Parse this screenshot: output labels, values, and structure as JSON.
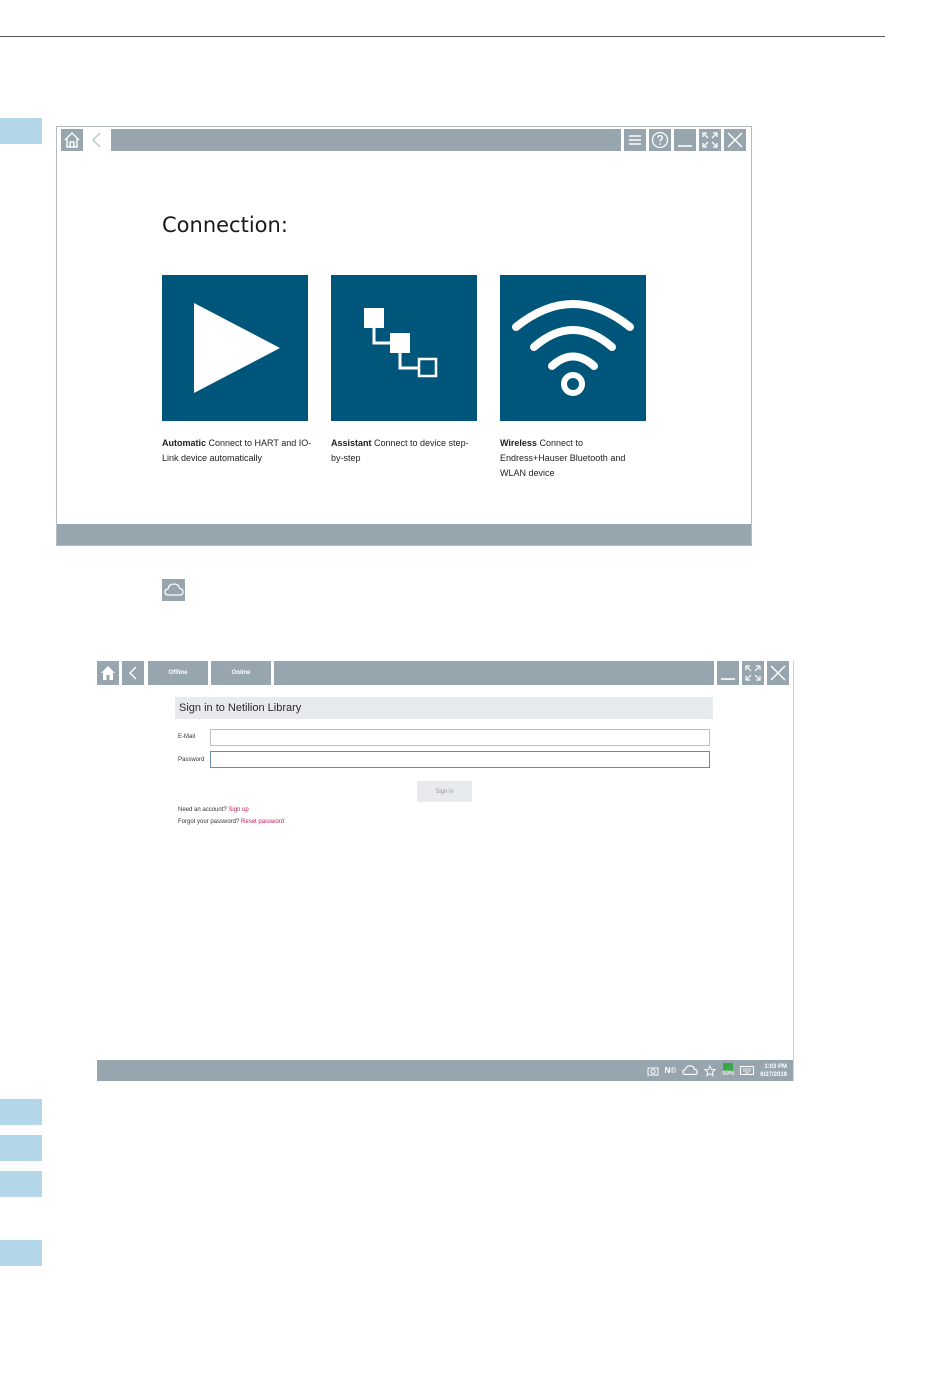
{
  "screen1": {
    "title": "Connection:",
    "tiles": [
      {
        "bold": "Automatic",
        "text": " Connect to HART and IO-Link device automatically"
      },
      {
        "bold": "Assistant",
        "text": " Connect to device step-by-step"
      },
      {
        "bold": "Wireless",
        "text": " Connect to Endress+Hauser Bluetooth and WLAN device"
      }
    ]
  },
  "screen2": {
    "tabs": {
      "offline": "Offline",
      "online": "Online"
    },
    "heading": "Sign in to Netilion Library",
    "email_label": "E-Mail",
    "password_label": "Password",
    "email_value": "",
    "password_value": "",
    "signin_label": "Sign in",
    "need_account": "Need an account?",
    "sign_up": "Sign up",
    "forgot": "Forgot your password?",
    "reset": "Reset password",
    "tray": {
      "nfc": "N©",
      "battery": "99%",
      "time": "1:03 PM",
      "date": "6/27/2019"
    }
  },
  "colors": {
    "tile": "#00557a",
    "toolbar": "#96a5ae",
    "link": "#c2185b",
    "step": "#b3d6e8"
  }
}
